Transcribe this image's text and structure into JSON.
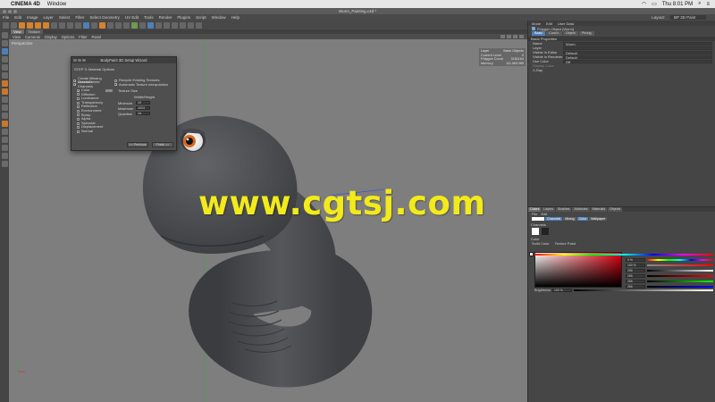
{
  "mac_menubar": {
    "app_name": "CINEMA 4D",
    "items": [
      "Window"
    ],
    "time": "Thu 8:01 PM"
  },
  "window": {
    "title": "Worm_Painting.c4d *"
  },
  "menubar": {
    "items": [
      "File",
      "Edit",
      "Image",
      "Layer",
      "Select",
      "Filter",
      "Select Geometry",
      "UV Edit",
      "Tools",
      "Render",
      "Plugins",
      "Script",
      "Window",
      "Help"
    ],
    "layout_label": "Layout:",
    "layout_value": "BP 3D Paint"
  },
  "viewport": {
    "tabs": [
      "View",
      "Texture"
    ],
    "menu": [
      "View",
      "Cameras",
      "Display",
      "Options",
      "Filter",
      "Panel"
    ],
    "projection_label": "Perspective",
    "stats": [
      {
        "label": "Layer",
        "value": "Base Objects"
      },
      {
        "label": "Current Level",
        "value": "0"
      },
      {
        "label": "Polygon Count",
        "value": "3181164"
      },
      {
        "label": "Memory",
        "value": "111.063 MB"
      }
    ]
  },
  "wizard": {
    "title": "BodyPaint 3D Setup Wizard",
    "step_label": "STEP 3: Material Options",
    "left_checks": [
      {
        "label": "Create Missing Materials",
        "checked": true
      },
      {
        "label": "Create/Delete Channels",
        "checked": true
      }
    ],
    "channels": [
      {
        "label": "Color",
        "checked": true
      },
      {
        "label": "Diffusion",
        "checked": false
      },
      {
        "label": "Luminance",
        "checked": false
      },
      {
        "label": "Transparency",
        "checked": false
      },
      {
        "label": "Reflection",
        "checked": false
      },
      {
        "label": "Environment",
        "checked": false
      },
      {
        "label": "Bump",
        "checked": false
      },
      {
        "label": "Alpha",
        "checked": false
      },
      {
        "label": "Specular",
        "checked": false
      },
      {
        "label": "Displacement",
        "checked": false
      },
      {
        "label": "Normal",
        "checked": false
      }
    ],
    "right_checks": [
      {
        "label": "Recycle Existing Textures",
        "checked": false
      },
      {
        "label": "Automatic Texture Interpolation",
        "checked": true
      }
    ],
    "texture_size_label": "Texture Size",
    "width_height_label": "Width/Height",
    "fields": [
      {
        "label": "Minimum",
        "value": "10"
      },
      {
        "label": "Maximum",
        "value": "1024"
      },
      {
        "label": "Quantize",
        "value": "16"
      }
    ],
    "prev_button": "<< Previous",
    "finish_button": "Finish >>"
  },
  "attributes": {
    "header_items": [
      "Mode",
      "Edit",
      "User Data"
    ],
    "object_name": "Polygon Object [Worm]",
    "tabs": [
      "Basic",
      "Coord.",
      "Object",
      "Phong"
    ],
    "section": "Basic Properties",
    "props": [
      {
        "label": "Name",
        "value": "Worm"
      },
      {
        "label": "Layer",
        "value": ""
      },
      {
        "label": "Visible in Editor",
        "value": "Default"
      },
      {
        "label": "Visible in Renderer",
        "value": "Default"
      },
      {
        "label": "Use Color",
        "value": "Off"
      },
      {
        "label": "Display Color",
        "value": ""
      },
      {
        "label": "X-Ray",
        "value": ""
      }
    ]
  },
  "color_panel": {
    "tabs": [
      "Colors",
      "Layers",
      "Brushes",
      "Attributes",
      "Materials",
      "Objects"
    ],
    "sub_items": [
      "File",
      "Edit"
    ],
    "mode_pills": [
      "Channels",
      "Mixing",
      "Color",
      "Wallpaper"
    ],
    "channels_label": "Channels",
    "color_label": "Color",
    "mode_items": [
      "Solid Color",
      "Texture Paint"
    ],
    "sliders": [
      {
        "value": "0 %",
        "color": "linear-gradient(to right,#f00,#ff0,#0f0,#0ff,#00f,#f0f,#f00)"
      },
      {
        "value": "100 %",
        "color": "linear-gradient(to right,#888,#f00)"
      },
      {
        "value": "255",
        "color": "linear-gradient(to right,#000,#fff)"
      },
      {
        "value": "255",
        "color": "linear-gradient(to right,#000,#f00)"
      },
      {
        "value": "255",
        "color": "linear-gradient(to right,#000,#0f0)"
      },
      {
        "value": "255",
        "color": "linear-gradient(to right,#000,#00f)"
      }
    ],
    "brightness_label": "Brightness",
    "brightness_value": "100 %"
  },
  "watermark": {
    "text": "www.cgtsj.com"
  },
  "colors": {
    "worm_body": "#4d4f52",
    "eye_iris": "#d9691d",
    "accent": "#4d7fb8",
    "watermark": "#f2ea1a"
  }
}
